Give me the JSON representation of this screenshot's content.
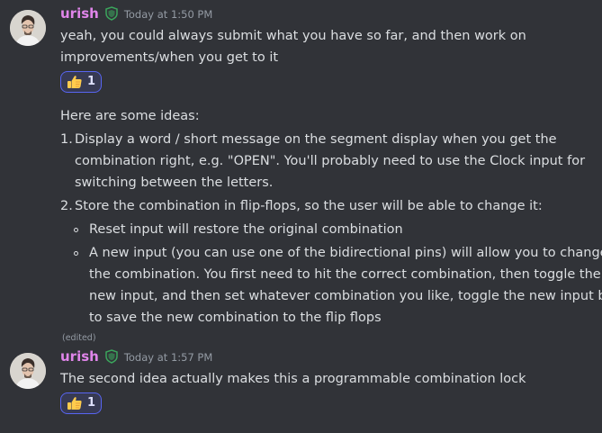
{
  "messages": [
    {
      "username": "urish",
      "timestamp": "Today at 1:50 PM",
      "lines": [
        "yeah, you could always submit what you have so far, and then work on",
        "improvements/when you get to it"
      ],
      "reaction": {
        "emoji": "thumbs-up-icon",
        "count": "1"
      },
      "intro": "Here are some ideas:",
      "list": [
        {
          "number": "1.",
          "lines": [
            "Display a word / short message on the segment display when you get the",
            "combination right, e.g. \"OPEN\". You'll probably need to use the Clock input for",
            "switching between the letters."
          ]
        },
        {
          "number": "2.",
          "lines": [
            "Store the combination in flip-flops, so the user will be able to change it:"
          ],
          "subitems": [
            {
              "lines": [
                "Reset input will restore the original combination"
              ]
            },
            {
              "lines": [
                "A new input (you can use one of the bidirectional pins) will allow you to change",
                "the combination. You first need to hit the correct combination, then toggle the",
                "new input, and then set whatever combination you like, toggle the new input back",
                "to save the new combination to the flip flops"
              ]
            }
          ]
        }
      ],
      "edited": "(edited)"
    },
    {
      "username": "urish",
      "timestamp": "Today at 1:57 PM",
      "text": "The second idea actually makes this a programmable combination lock",
      "reaction": {
        "emoji": "thumbs-up-icon",
        "count": "1"
      }
    }
  ],
  "colors": {
    "background": "#313338",
    "username": "#e085ea",
    "text": "#dbdee1",
    "muted": "#949ba4",
    "reaction_border": "#5865f2",
    "reaction_bg": "#373a53"
  }
}
